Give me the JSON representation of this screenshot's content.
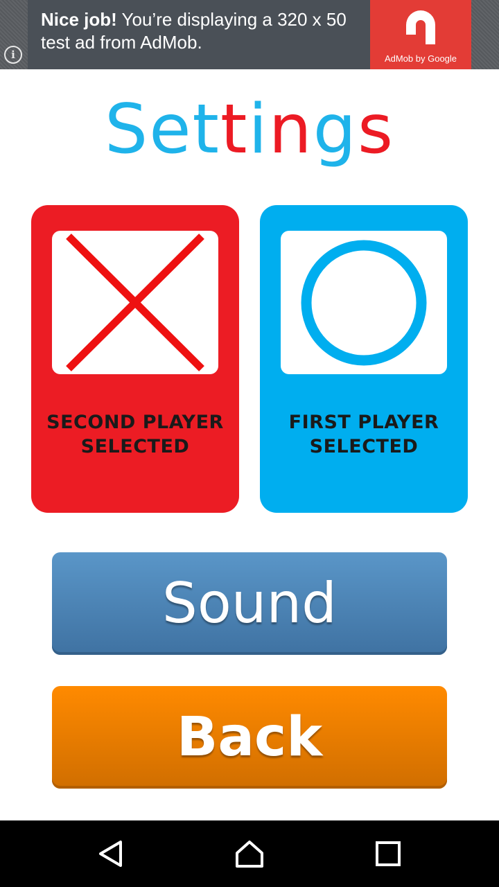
{
  "ad": {
    "headline_bold": "Nice job!",
    "headline_rest": " You’re displaying a 320 x 50 test ad from AdMob.",
    "logo_caption": "AdMob by Google",
    "info_icon": "info-icon",
    "colors": {
      "banner": "#4a5057",
      "logo_bg": "#e33c36"
    }
  },
  "title": {
    "parts": [
      "S",
      "e",
      "t",
      "t",
      "i",
      "n",
      "g",
      "s"
    ],
    "colors": [
      "#1fb3ea",
      "#1fb3ea",
      "#1fb3ea",
      "#ec1b24",
      "#1fb3ea",
      "#ec1b24",
      "#1fb3ea",
      "#ec1b24"
    ]
  },
  "players": {
    "second": {
      "label": "SECOND PLAYER\nSELECTED",
      "icon": "x-mark-icon",
      "color": "#ec1c24"
    },
    "first": {
      "label": "FIRST PLAYER\nSELECTED",
      "icon": "circle-o-icon",
      "color": "#00aeef"
    }
  },
  "buttons": {
    "sound_label": "Sound",
    "back_label": "Back"
  },
  "navbar": {
    "back_icon": "back-triangle-icon",
    "home_icon": "home-icon",
    "recent_icon": "recent-apps-icon"
  }
}
